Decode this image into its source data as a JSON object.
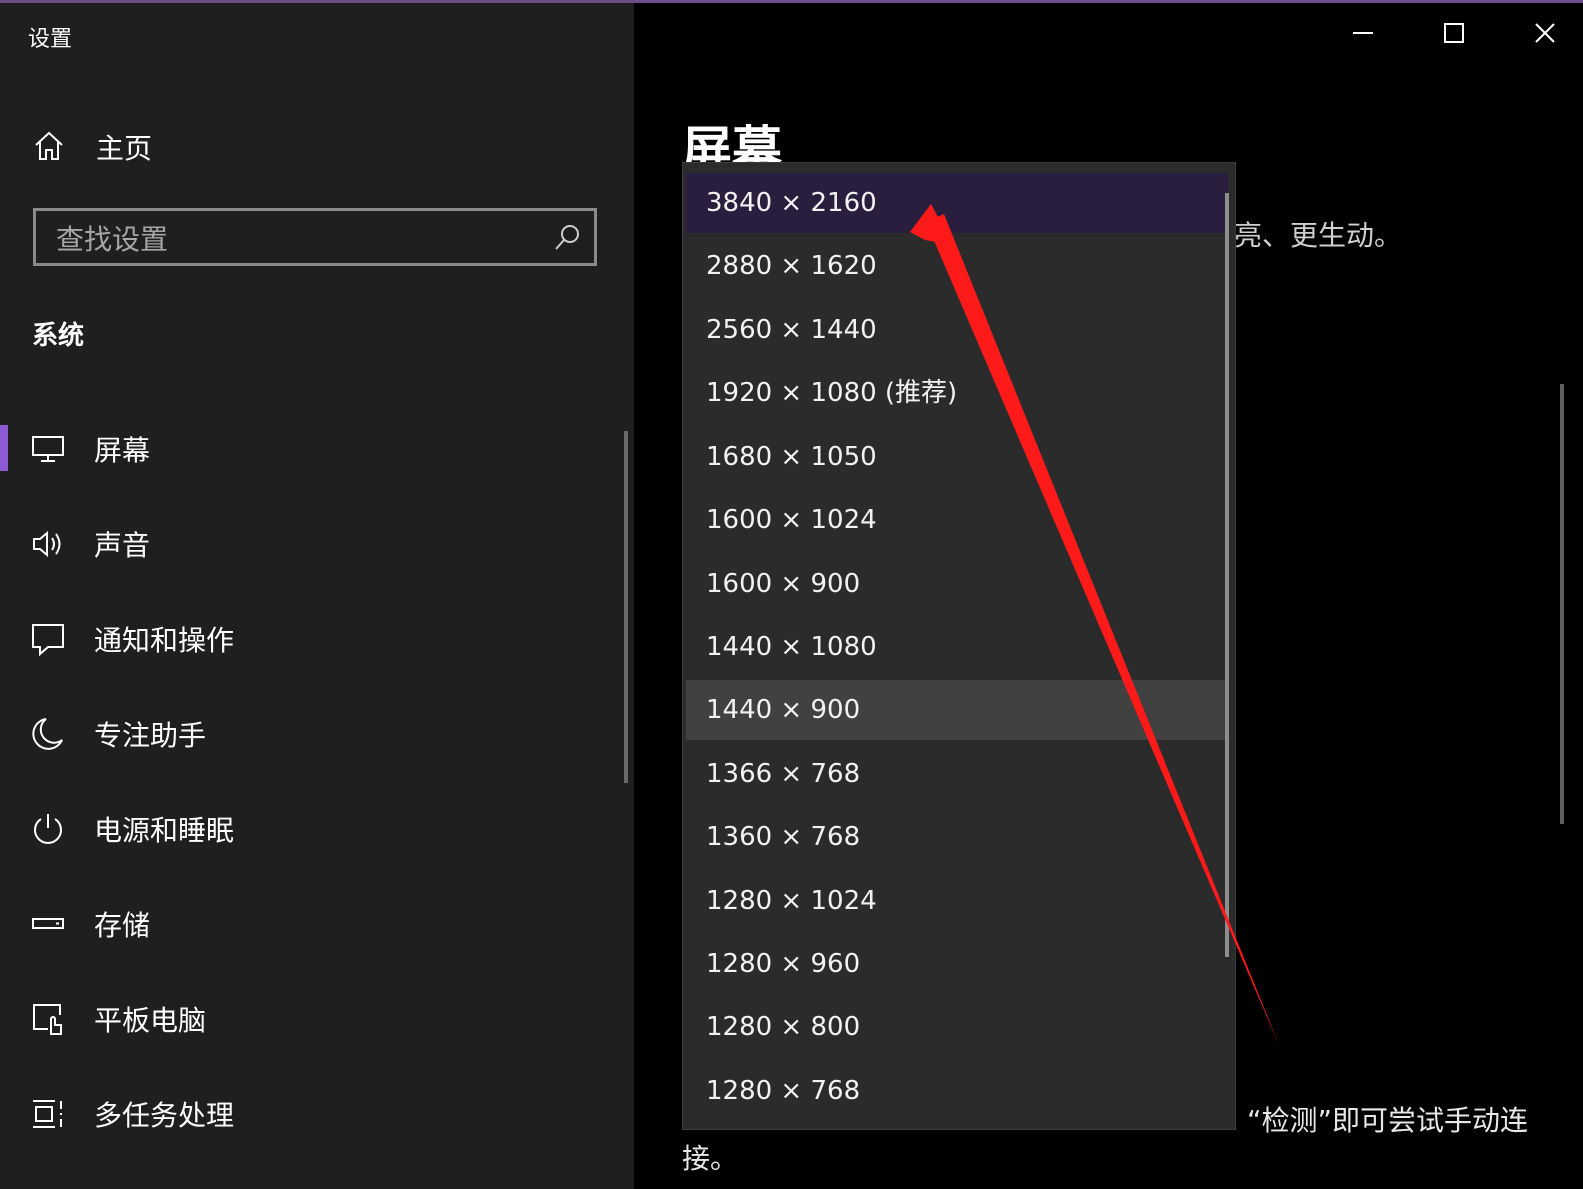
{
  "window": {
    "title": "设置",
    "controls": [
      "minimize-icon",
      "maximize-icon",
      "close-icon"
    ],
    "accent_color": "#6b4e8c"
  },
  "sidebar": {
    "home_label": "主页",
    "search_placeholder": "查找设置",
    "section_title": "系统",
    "items": [
      {
        "label": "屏幕",
        "icon": "monitor-icon",
        "active": true
      },
      {
        "label": "声音",
        "icon": "speaker-icon"
      },
      {
        "label": "通知和操作",
        "icon": "notification-icon"
      },
      {
        "label": "专注助手",
        "icon": "moon-icon"
      },
      {
        "label": "电源和睡眠",
        "icon": "power-icon"
      },
      {
        "label": "存储",
        "icon": "storage-icon"
      },
      {
        "label": "平板电脑",
        "icon": "tablet-icon"
      },
      {
        "label": "多任务处理",
        "icon": "multitasking-icon"
      }
    ]
  },
  "main": {
    "title": "屏幕",
    "desc_fragment": "亮、更生动。",
    "bottom_text_part1": "“检测”即可尝试手动连",
    "bottom_text_part2": "接。"
  },
  "resolution_dropdown": {
    "selected": "3840 × 2160",
    "hovered": "1440 × 900",
    "options": [
      "3840 × 2160",
      "2880 × 1620",
      "2560 × 1440",
      "1920 × 1080 (推荐)",
      "1680 × 1050",
      "1600 × 1024",
      "1600 × 900",
      "1440 × 1080",
      "1440 × 900",
      "1366 × 768",
      "1360 × 768",
      "1280 × 1024",
      "1280 × 960",
      "1280 × 800",
      "1280 × 768"
    ]
  },
  "annotation": {
    "type": "arrow",
    "color": "#ff1a1a"
  }
}
